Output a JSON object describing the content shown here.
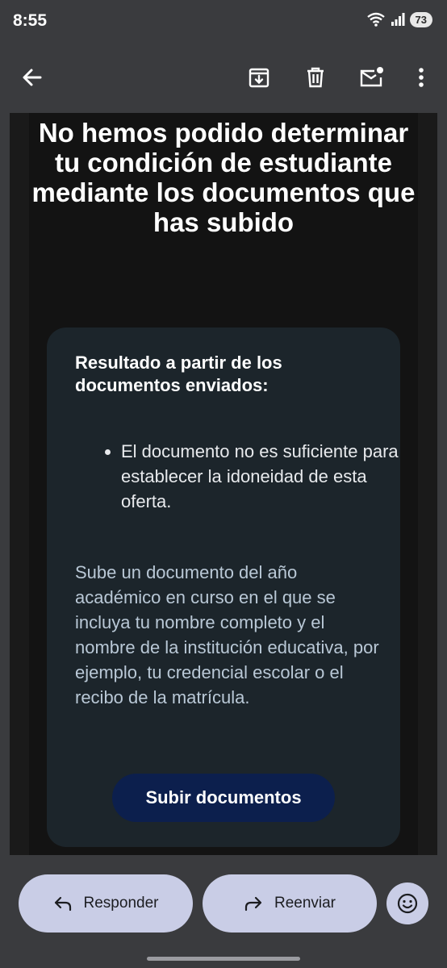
{
  "status_bar": {
    "time": "8:55",
    "battery": "73"
  },
  "email": {
    "title": "No hemos podido determinar tu condición de estudiante mediante los documentos que has subido",
    "card": {
      "heading": "Resultado a partir de los documentos enviados:",
      "bullets": [
        "El documento no es suficiente para establecer la idoneidad de esta oferta."
      ],
      "paragraph": "Sube un documento del año académico en curso en el que se incluya tu nombre completo y el nombre de la institución educativa, por ejemplo, tu credencial escolar o el recibo de la matrícula.",
      "button_label": "Subir documentos"
    }
  },
  "actions": {
    "reply_label": "Responder",
    "forward_label": "Reenviar"
  },
  "colors": {
    "card_bg": "#1c252b",
    "cta_bg": "#0c1f4d",
    "pill_bg": "#c9cde6"
  }
}
